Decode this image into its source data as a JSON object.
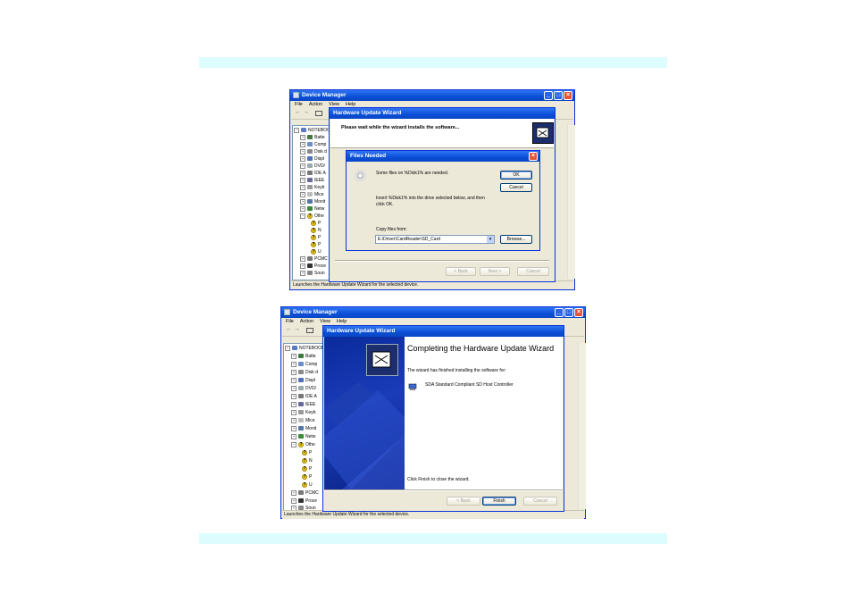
{
  "shot1": {
    "device_manager": {
      "title": "Device Manager",
      "menu": [
        "File",
        "Action",
        "View",
        "Help"
      ],
      "tree_root": "NOTEBOOK",
      "tree_items": [
        "Batte",
        "Comp",
        "Disk d",
        "Displ",
        "DVD/",
        "IDE A",
        "IEEE",
        "Keyb",
        "Mice",
        "Monit",
        "Netw",
        "Othe",
        "P",
        "N",
        "P",
        "P",
        "U",
        "PCMC",
        "Proce",
        "Soun"
      ],
      "status": "Launches the Hardware Update Wizard for the selected device."
    },
    "wizard": {
      "title": "Hardware Update Wizard",
      "header": "Please wait while the wizard installs the software...",
      "back": "< Back",
      "next": "Next >",
      "cancel": "Cancel"
    },
    "files_needed": {
      "title": "Files Needed",
      "message1": "Some files on %Disk1% are needed.",
      "message2": "Insert %Disk1% into the drive selected below, and then click OK.",
      "copy_label": "Copy files from:",
      "path_value": "E:\\Driver\\CardReader\\SD_Card",
      "ok": "OK",
      "cancel": "Cancel",
      "browse": "Browse..."
    }
  },
  "shot2": {
    "device_manager": {
      "title": "Device Manager",
      "menu": [
        "File",
        "Action",
        "View",
        "Help"
      ],
      "tree_root": "NOTEBOOK",
      "tree_items": [
        "Batte",
        "Comp",
        "Disk d",
        "Displ",
        "DVD/",
        "IDE A",
        "IEEE",
        "Keyb",
        "Mice",
        "Monit",
        "Netw",
        "Othe",
        "P",
        "N",
        "P",
        "P",
        "U",
        "PCMC",
        "Proce",
        "Soun"
      ],
      "status": "Launches the Hardware Update Wizard for the selected device."
    },
    "wizard": {
      "title": "Hardware Update Wizard",
      "heading": "Completing the Hardware Update Wizard",
      "finished_text": "The wizard has finished installing the software for:",
      "device_name": "SDA Standard Compliant SD Host Controller",
      "finish_hint": "Click Finish to close the wizard.",
      "back": "< Back",
      "finish": "Finish",
      "cancel": "Cancel"
    }
  },
  "colors": {
    "band": "#ddfcfd",
    "xp_title_blue": "#0a4fd6",
    "dialog_face": "#ece9d8",
    "wizard_side_blue": "#0a2a9c"
  }
}
